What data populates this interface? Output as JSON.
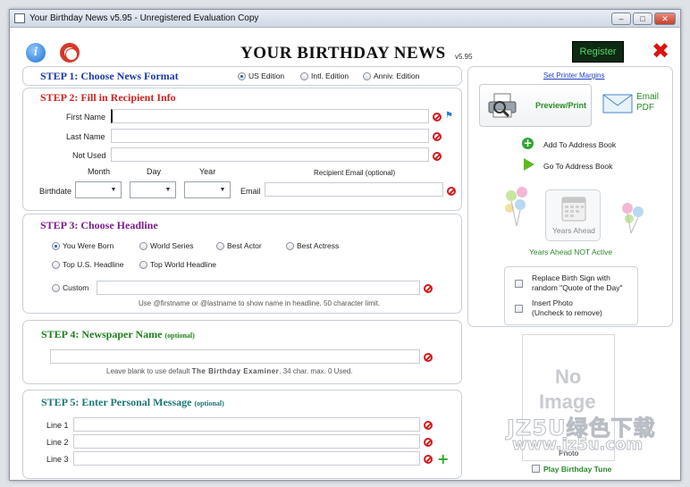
{
  "window": {
    "title": "Your Birthday News v5.95 - Unregistered Evaluation Copy"
  },
  "header": {
    "app_title": "YOUR BIRTHDAY NEWS",
    "version": "v5.95",
    "register": "Register"
  },
  "step1": {
    "title": "STEP 1: Choose News Format",
    "options": [
      "US Edition",
      "Intl. Edition",
      "Anniv. Edition"
    ],
    "selected": "US Edition"
  },
  "step2": {
    "title": "STEP 2: Fill in Recipient Info",
    "first_name_label": "First Name",
    "last_name_label": "Last Name",
    "not_used_label": "Not Used",
    "month_label": "Month",
    "day_label": "Day",
    "year_label": "Year",
    "birthdate_label": "Birthdate",
    "email_label": "Email",
    "recipient_email_label": "Recipient Email (optional)"
  },
  "step3": {
    "title": "STEP 3: Choose Headline",
    "options": [
      "You Were Born",
      "World Series",
      "Best Actor",
      "Best Actress",
      "Top U.S. Headline",
      "Top World Headline",
      "Custom"
    ],
    "selected": "You Were Born",
    "hint": "Use @firstname or @lastname to show name in headline. 50 character limit."
  },
  "step4": {
    "title": "STEP 4: Newspaper Name",
    "optional": "(optional)",
    "hint_pre": "Leave blank to use default ",
    "hint_name": "The Birthday Examiner",
    "hint_post": ". 34 char. max. 0 Used."
  },
  "step5": {
    "title": "STEP 5: Enter Personal Message",
    "optional": "(optional)",
    "lines": [
      "Line 1",
      "Line 2",
      "Line 3"
    ]
  },
  "sidebar": {
    "printer_margins": "Set Printer Margins",
    "preview_print": "Preview/Print",
    "email_pdf_1": "Email",
    "email_pdf_2": "PDF",
    "add_address": "Add To Address Book",
    "go_address": "Go To Address Book",
    "years_ahead": "Years Ahead",
    "years_ahead_status": "Years Ahead NOT Active",
    "replace_sign_1": "Replace Birth Sign with",
    "replace_sign_2": "random \"Quote of the Day\"",
    "insert_photo_1": "Insert Photo",
    "insert_photo_2": "(Uncheck to remove)",
    "no_image_1": "No",
    "no_image_2": "Image",
    "photo_label": "Photo",
    "play_tune": "Play Birthday Tune"
  },
  "watermark": {
    "line1": "JZ5U绿色下载",
    "line2": "www.jz5u.com"
  },
  "colors": {
    "step1": "#1b3aa8",
    "step2": "#d42121",
    "step3": "#7b1c8c",
    "step4": "#1e7f1e",
    "step5": "#1c7575",
    "register_text": "#59d46a"
  }
}
